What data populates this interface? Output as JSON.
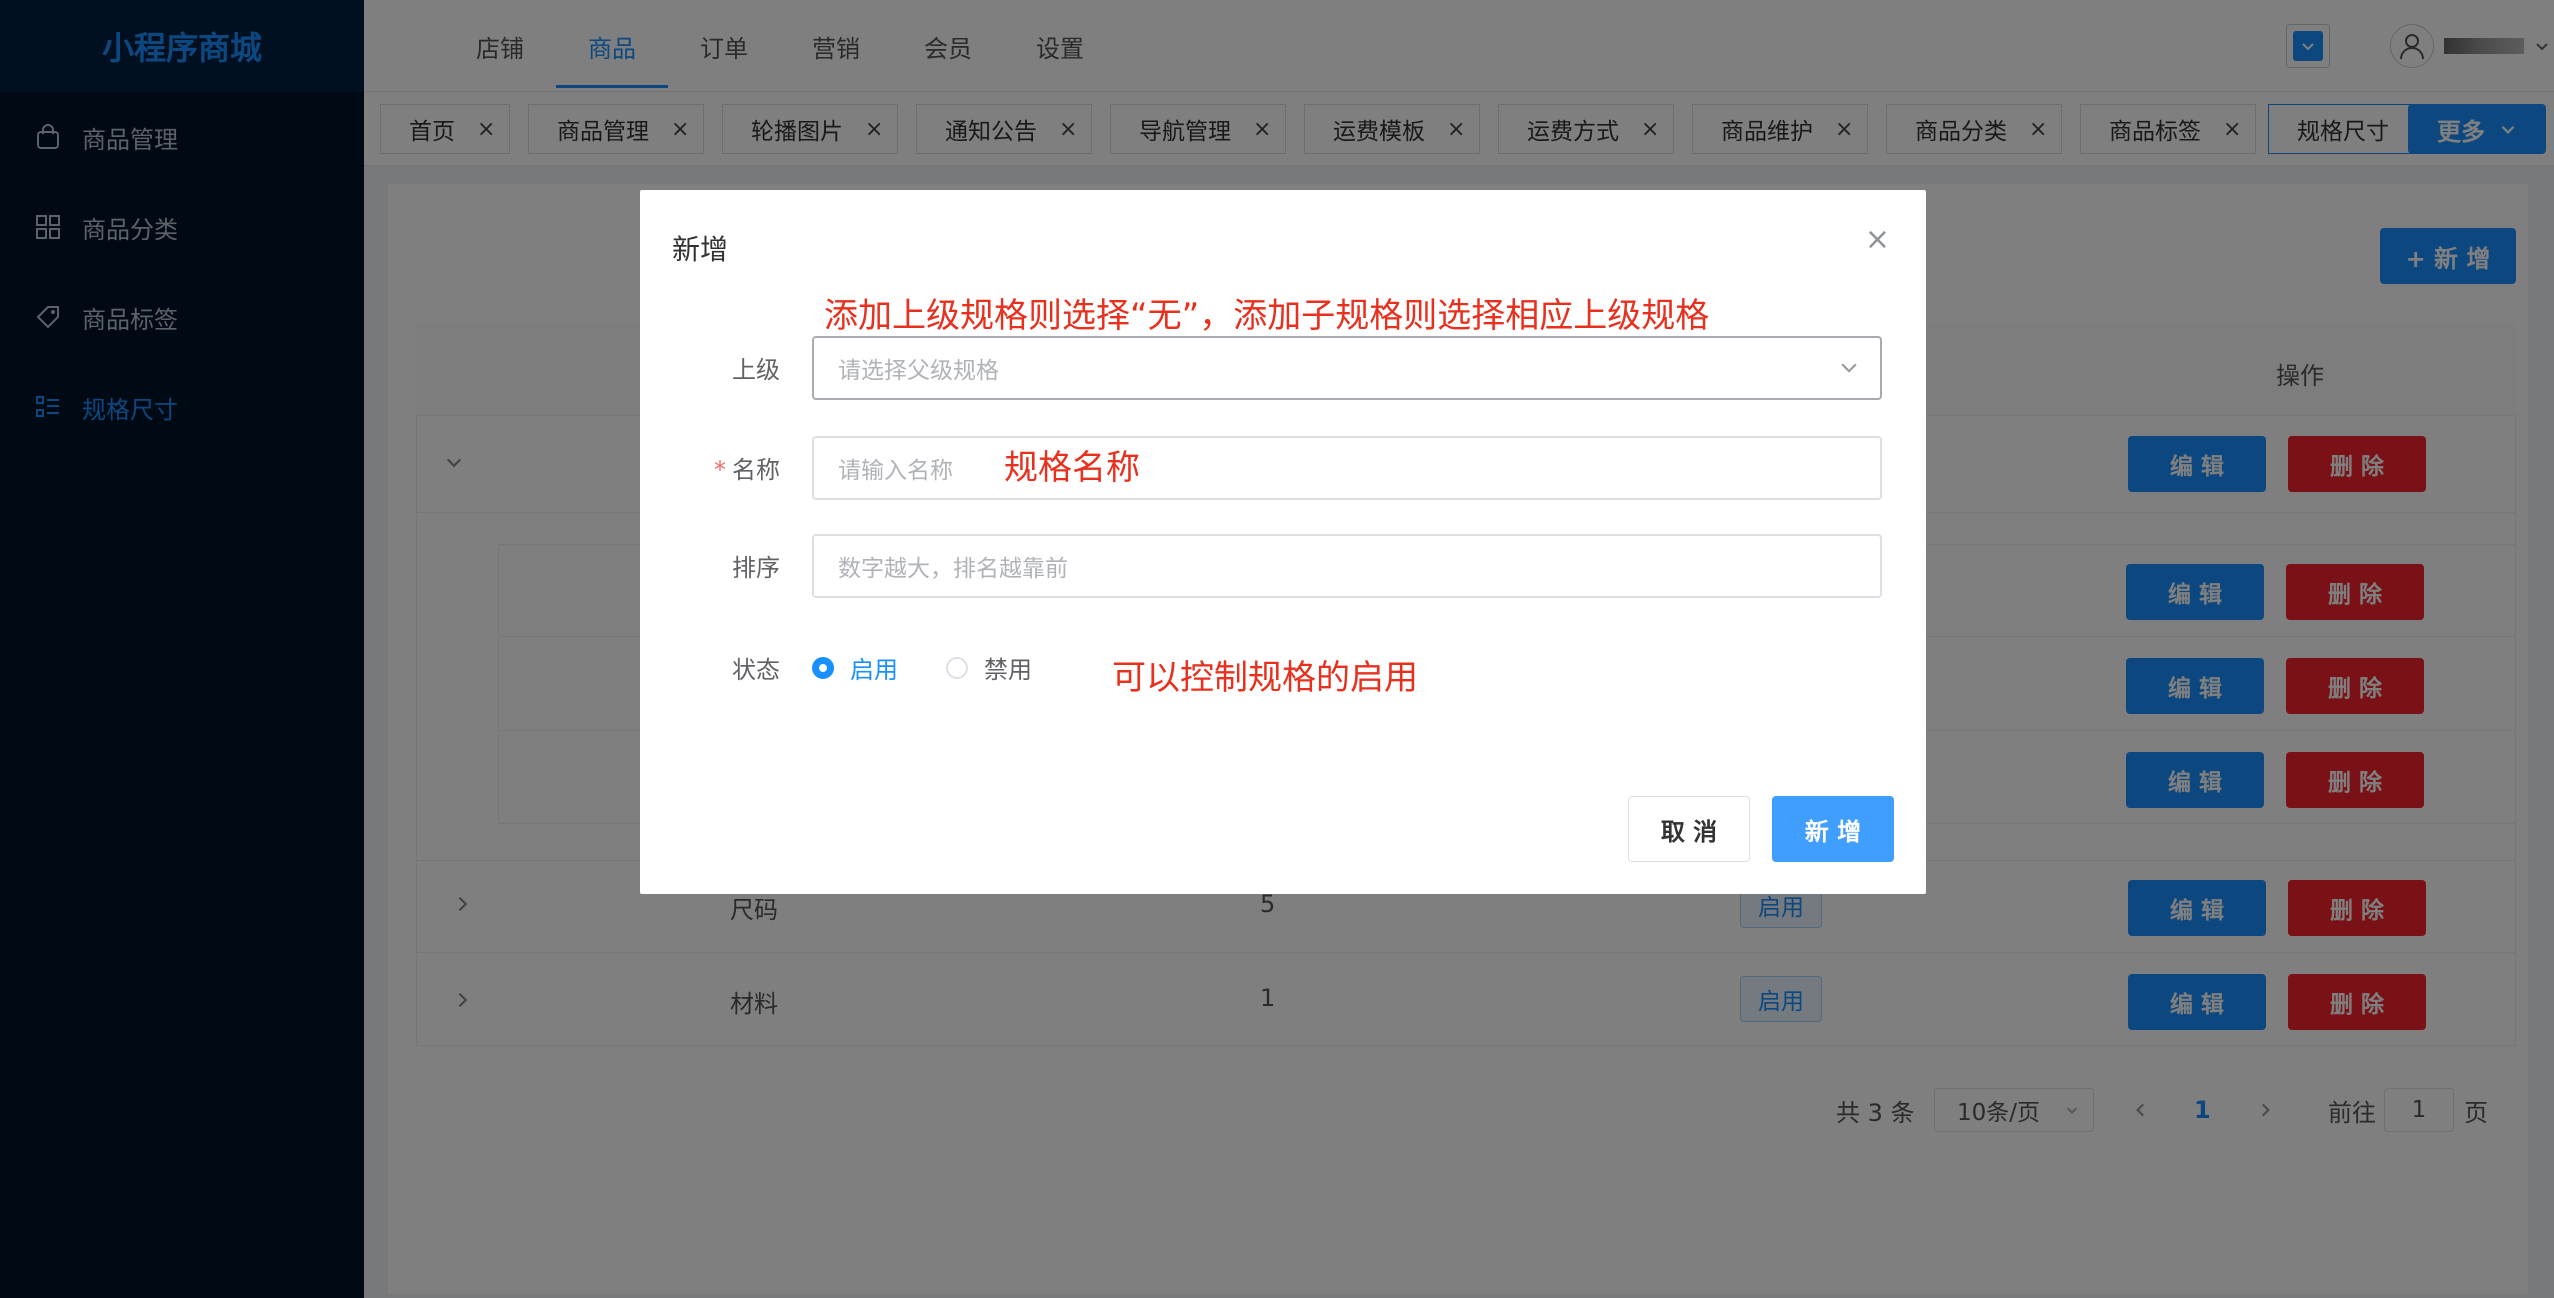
{
  "app": {
    "title": "小程序商城"
  },
  "sidebar": {
    "items": [
      {
        "label": "商品管理",
        "icon": "bag-icon"
      },
      {
        "label": "商品分类",
        "icon": "grid-icon"
      },
      {
        "label": "商品标签",
        "icon": "tag-icon"
      },
      {
        "label": "规格尺寸",
        "icon": "list-icon"
      }
    ],
    "active_index": 3
  },
  "topnav": {
    "items": [
      "店铺",
      "商品",
      "订单",
      "营销",
      "会员",
      "设置"
    ],
    "active_index": 1
  },
  "tabs": {
    "items": [
      "首页",
      "商品管理",
      "轮播图片",
      "通知公告",
      "导航管理",
      "运费模板",
      "运费方式",
      "商品维护",
      "商品分类",
      "商品标签",
      "规格尺寸"
    ],
    "active_index": 10,
    "close_glyph": "×",
    "more_label": "更多"
  },
  "page": {
    "add_label": "+ 新 增",
    "op_header": "操作",
    "edit_label": "编 辑",
    "delete_label": "删 除",
    "rows": [
      {
        "name": "尺码",
        "sort": "5",
        "status": "启用"
      },
      {
        "name": "材料",
        "sort": "1",
        "status": "启用"
      }
    ],
    "pagination": {
      "total": "共 3 条",
      "page_size": "10条/页",
      "current": "1",
      "goto_prefix": "前往",
      "goto_value": "1",
      "goto_suffix": "页"
    }
  },
  "dialog": {
    "title": "新增",
    "close_glyph": "×",
    "fields": {
      "parent": {
        "label": "上级",
        "placeholder": "请选择父级规格"
      },
      "name": {
        "label": "名称",
        "required_mark": "*",
        "placeholder": "请输入名称"
      },
      "sort": {
        "label": "排序",
        "placeholder": "数字越大，排名越靠前"
      },
      "status": {
        "label": "状态",
        "options": [
          "启用",
          "禁用"
        ],
        "selected": "启用"
      }
    },
    "annotations": {
      "parent": "添加上级规格则选择“无”，添加子规格则选择相应上级规格",
      "name": "规格名称",
      "status": "可以控制规格的启用"
    },
    "cancel_label": "取 消",
    "submit_label": "新 增"
  },
  "colors": {
    "primary": "#1890ff",
    "danger": "#f5222d",
    "sidebar_bg": "#001529",
    "annotation": "#e8301e"
  }
}
